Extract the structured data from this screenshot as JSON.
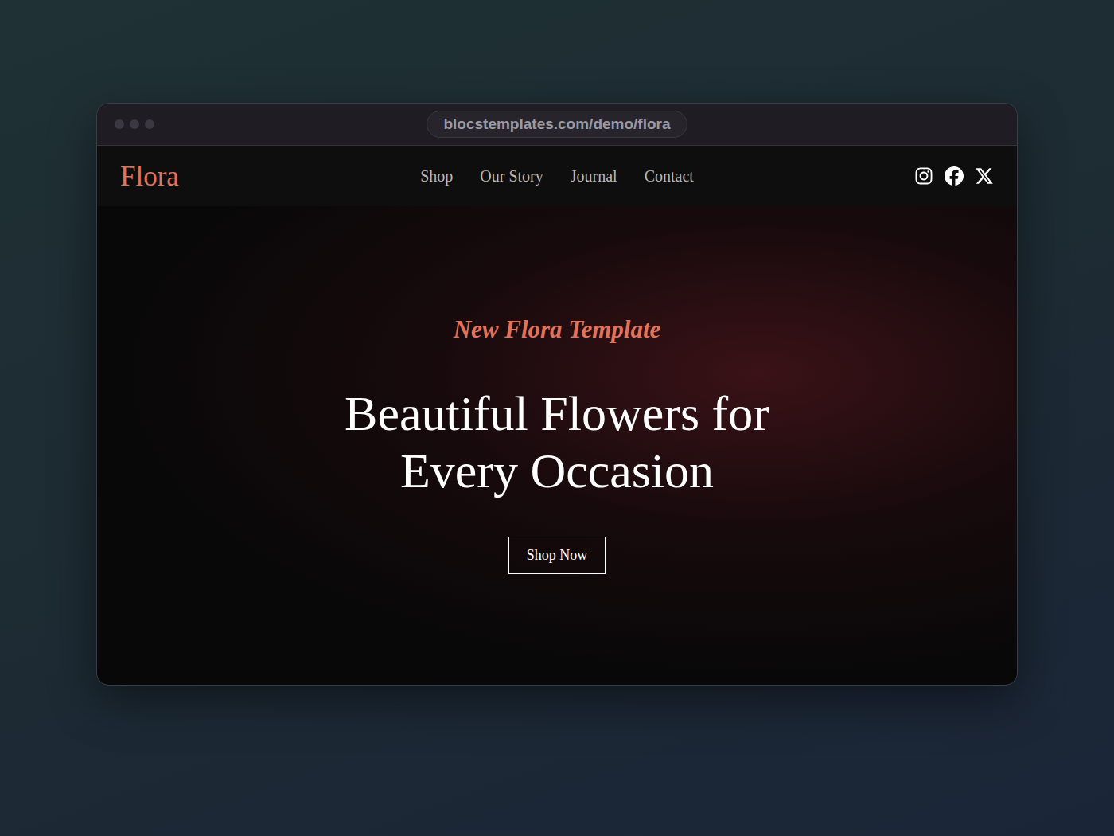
{
  "window": {
    "url": "blocstemplates.com/demo/flora"
  },
  "nav": {
    "logo": "Flora",
    "links": [
      {
        "label": "Shop",
        "selected": false
      },
      {
        "label": "Our Story",
        "selected": false
      },
      {
        "label": "Journal",
        "selected": false
      },
      {
        "label": "Contact",
        "selected": false
      }
    ]
  },
  "social": [
    {
      "kind": "instagram"
    },
    {
      "kind": "facebook"
    },
    {
      "kind": "x"
    }
  ],
  "hero": {
    "tagline": "New Flora Template",
    "heading": [
      "Beautiful Flowers for",
      "Every Occasion"
    ],
    "button": "Shop Now"
  }
}
